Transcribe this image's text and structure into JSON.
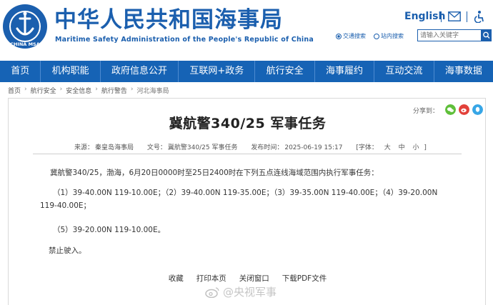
{
  "header": {
    "title": "中华人民共和国海事局",
    "subtitle": "Maritime Safety Administration of the People's Republic of China",
    "logo_text": "CHINA MSA",
    "lang_link": "English",
    "search": {
      "option1": "交通搜索",
      "option2": "站内搜索",
      "placeholder": "请输入关键字"
    }
  },
  "nav": {
    "items": [
      "首页",
      "机构职能",
      "政府信息公开",
      "互联网+政务",
      "航行安全",
      "海事履约",
      "互动交流",
      "海事数据"
    ]
  },
  "breadcrumb": [
    "首页",
    "航行安全",
    "安全信息",
    "航行警告",
    "河北海事局"
  ],
  "article": {
    "share_label": "分享到：",
    "title": "冀航警340/25 军事任务",
    "meta": {
      "source_label": "来源：",
      "source": "秦皇岛海事局",
      "doc_label": "文号：",
      "doc_no": "冀航警340/25 军事任务",
      "date_label": "发布时间：",
      "date": "2025-06-19 15:17",
      "font_label": "[字体：",
      "size_large": "大",
      "size_medium": "中",
      "size_small": "小",
      "font_close": "]"
    },
    "paragraphs": [
      "冀航警340/25，渤海，6月20日0000时至25日2400时在下列五点连线海域范围内执行军事任务：",
      "（1）39-40.00N 119-10.00E；（2）39-40.00N 119-35.00E；（3）39-35.00N 119-40.00E；（4）39-20.00N 119-40.00E；",
      "（5）39-20.00N 119-10.00E。",
      "禁止驶入。"
    ],
    "actions": [
      "收藏",
      "打印本页",
      "关闭窗口",
      "下载PDF文件"
    ]
  },
  "watermark": "@央视军事",
  "colors": {
    "brand_blue": "#1b5fae",
    "nav_blue": "#1663b5"
  }
}
